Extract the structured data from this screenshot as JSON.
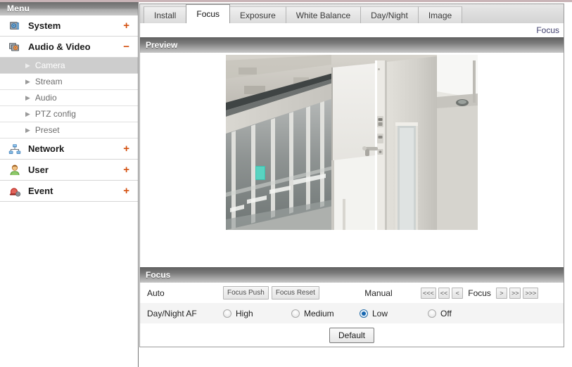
{
  "sidebar": {
    "header": "Menu",
    "items": [
      {
        "label": "System",
        "icon": "system-camera-gear-icon",
        "toggle": "+",
        "expanded": false
      },
      {
        "label": "Audio & Video",
        "icon": "audio-video-camera-icon",
        "toggle": "−",
        "expanded": true
      },
      {
        "label": "Network",
        "icon": "network-nodes-icon",
        "toggle": "+",
        "expanded": false
      },
      {
        "label": "User",
        "icon": "user-person-icon",
        "toggle": "+",
        "expanded": false
      },
      {
        "label": "Event",
        "icon": "event-alert-gear-icon",
        "toggle": "+",
        "expanded": false
      }
    ],
    "subitems": [
      {
        "label": "Camera",
        "selected": true
      },
      {
        "label": "Stream",
        "selected": false
      },
      {
        "label": "Audio",
        "selected": false
      },
      {
        "label": "PTZ config",
        "selected": false
      },
      {
        "label": "Preset",
        "selected": false
      }
    ],
    "toggle_color": "#d4500f"
  },
  "tabs": [
    {
      "label": "Install",
      "active": false
    },
    {
      "label": "Focus",
      "active": true
    },
    {
      "label": "Exposure",
      "active": false
    },
    {
      "label": "White Balance",
      "active": false
    },
    {
      "label": "Day/Night",
      "active": false
    },
    {
      "label": "Image",
      "active": false
    }
  ],
  "breadcrumb": "Focus",
  "preview": {
    "header": "Preview",
    "image_alt": "live-camera-preview-office-corridor-glass-partitions-door"
  },
  "focus": {
    "header": "Focus",
    "auto": {
      "label": "Auto",
      "focus_push": "Focus Push",
      "focus_reset": "Focus Reset"
    },
    "manual": {
      "label": "Manual",
      "center_label": "Focus",
      "buttons_left": [
        "<<<",
        "<<",
        "<"
      ],
      "buttons_right": [
        ">",
        ">>",
        ">>>"
      ]
    },
    "day_night_af": {
      "label": "Day/Night AF",
      "options": [
        {
          "label": "High",
          "checked": false
        },
        {
          "label": "Medium",
          "checked": false
        },
        {
          "label": "Low",
          "checked": true
        },
        {
          "label": "Off",
          "checked": false
        }
      ],
      "selected": "Low"
    },
    "default_button": "Default"
  },
  "colors": {
    "accent_orange": "#d4500f",
    "radio_blue": "#1666b0",
    "header_gray_dark": "#5f5f5f",
    "header_gray_light": "#c6c6c6",
    "selected_row": "#cdcdcd"
  }
}
